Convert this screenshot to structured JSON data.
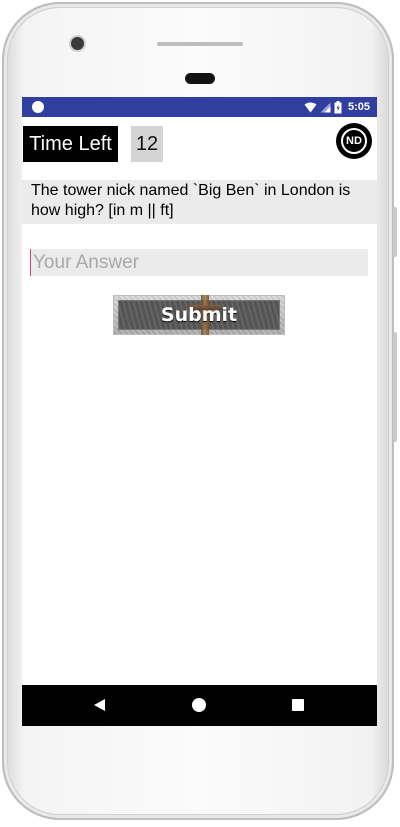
{
  "status_bar": {
    "time": "5:05",
    "background_color": "#303f9f"
  },
  "quiz": {
    "timer_label": "Time Left",
    "timer_value": "12",
    "logo_text": "ND",
    "question": "The tower nick named `Big Ben` in London is how high? [in m || ft]",
    "answer_placeholder": "Your Answer",
    "answer_value": "",
    "submit_label": "Submit"
  },
  "nav_bar": {
    "back_icon": "back-triangle-icon",
    "home_icon": "home-circle-icon",
    "recents_icon": "recents-square-icon"
  }
}
